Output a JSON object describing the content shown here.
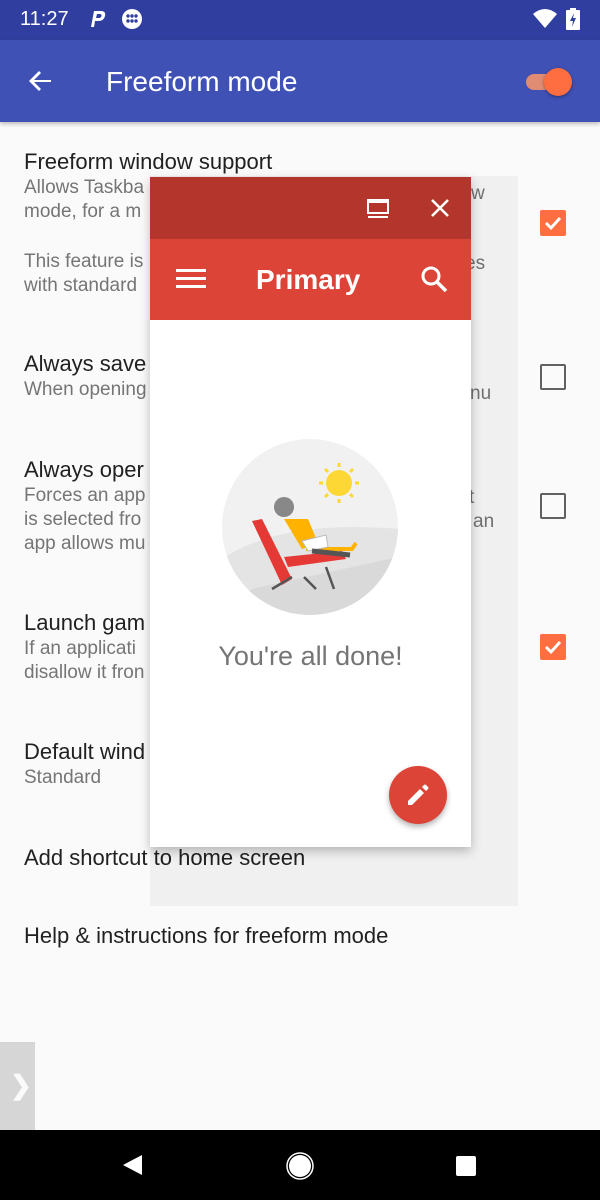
{
  "status_bar": {
    "time": "11:27",
    "icons": [
      "p-icon",
      "dots-icon",
      "wifi-icon",
      "battery-icon"
    ]
  },
  "app_bar": {
    "title": "Freeform mode",
    "back_icon": "arrow-back-icon",
    "master_toggle_on": true
  },
  "preferences": [
    {
      "title": "Freeform window support",
      "summary_lines": [
        "Allows Taskba",
        "mode, for a m"
      ],
      "summary_right": [
        "w",
        ""
      ],
      "checked": true
    },
    {
      "title": "",
      "summary_lines": [
        "This feature is",
        "with standard"
      ],
      "summary_right": [
        "es",
        ""
      ]
    },
    {
      "title": "Always save",
      "summary_lines": [
        "When opening"
      ],
      "summary_right": [
        "nu"
      ],
      "checked": false
    },
    {
      "title": "Always oper",
      "summary_lines": [
        "Forces an app",
        "is selected fro",
        "app allows mu"
      ],
      "summary_right": [
        "t",
        "an",
        ""
      ],
      "checked": false
    },
    {
      "title": "Launch gam",
      "summary_lines": [
        "If an applicati",
        "disallow it fron"
      ],
      "checked": true
    },
    {
      "title": "Default wind",
      "summary_lines": [
        "Standard"
      ]
    },
    {
      "title": "Add shortcut to home screen"
    },
    {
      "title": "Help & instructions for freeform mode"
    }
  ],
  "freeform_window": {
    "caption_icons": [
      "maximize-icon",
      "close-icon"
    ],
    "app_title": "Primary",
    "empty_message": "You're all done!",
    "fab_icon": "pencil-icon"
  },
  "side_handle": {
    "glyph": "❯"
  },
  "nav_bar": {
    "buttons": [
      "back",
      "home",
      "recents"
    ]
  },
  "colors": {
    "primary": "#3f51b5",
    "primary_dark": "#303f9f",
    "accent": "#ff6e40",
    "gmail_red": "#db4437",
    "gmail_caption": "#b3352b"
  }
}
